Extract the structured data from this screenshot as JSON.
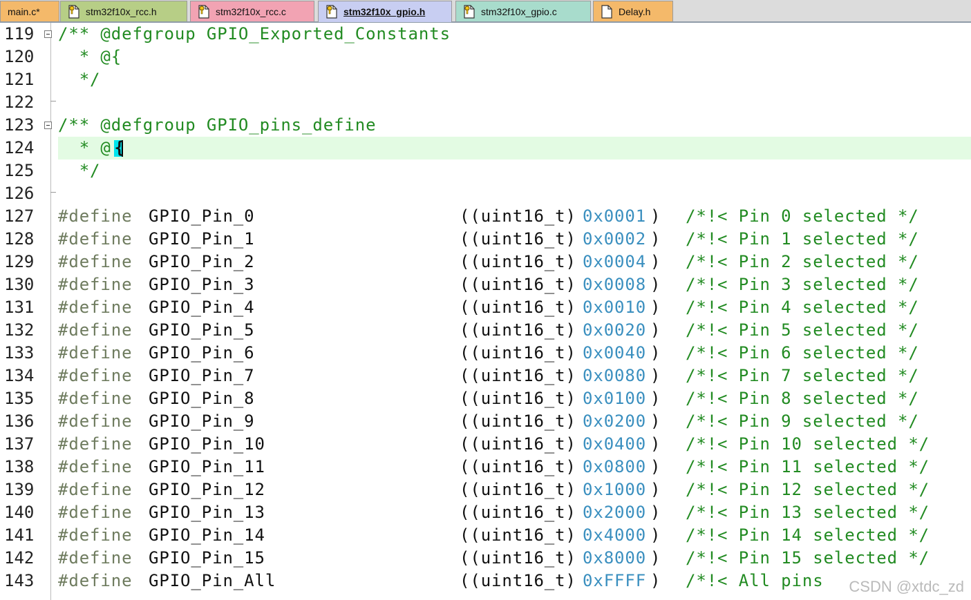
{
  "tabs": [
    {
      "label": "main.c*",
      "color": "#f4b96a",
      "icon": "none"
    },
    {
      "label": "stm32f10x_rcc.h",
      "color": "#b7ce86",
      "icon": "file-key-icon"
    },
    {
      "label": "stm32f10x_rcc.c",
      "color": "#f2a3b3",
      "icon": "file-key-icon"
    },
    {
      "label": "stm32f10x_gpio.h",
      "color": "#c8cef2",
      "icon": "file-key-icon",
      "active": true
    },
    {
      "label": "stm32f10x_gpio.c",
      "color": "#a8dccc",
      "icon": "file-key-icon"
    },
    {
      "label": "Delay.h",
      "color": "#f4b96a",
      "icon": "file-icon"
    }
  ],
  "lines": [
    {
      "num": "119",
      "fold": true,
      "comment": "/** @defgroup GPIO_Exported_Constants"
    },
    {
      "num": "120",
      "comment": "  * @{"
    },
    {
      "num": "121",
      "comment": "  */"
    },
    {
      "num": "122",
      "foldtail": true
    },
    {
      "num": "123",
      "fold": true,
      "comment": "/** @defgroup GPIO_pins_define"
    },
    {
      "num": "124",
      "current": true,
      "comment": "  * @",
      "cursor_char": "{"
    },
    {
      "num": "125",
      "comment": "  */"
    },
    {
      "num": "126",
      "foldtail": true
    },
    {
      "num": "127",
      "define": "#define",
      "name": "GPIO_Pin_0",
      "cast": "((uint16_t)",
      "value": "0x0001",
      "close": ")",
      "comment": "/*!< Pin 0 selected */"
    },
    {
      "num": "128",
      "define": "#define",
      "name": "GPIO_Pin_1",
      "cast": "((uint16_t)",
      "value": "0x0002",
      "close": ")",
      "comment": "/*!< Pin 1 selected */"
    },
    {
      "num": "129",
      "define": "#define",
      "name": "GPIO_Pin_2",
      "cast": "((uint16_t)",
      "value": "0x0004",
      "close": ")",
      "comment": "/*!< Pin 2 selected */"
    },
    {
      "num": "130",
      "define": "#define",
      "name": "GPIO_Pin_3",
      "cast": "((uint16_t)",
      "value": "0x0008",
      "close": ")",
      "comment": "/*!< Pin 3 selected */"
    },
    {
      "num": "131",
      "define": "#define",
      "name": "GPIO_Pin_4",
      "cast": "((uint16_t)",
      "value": "0x0010",
      "close": ")",
      "comment": "/*!< Pin 4 selected */"
    },
    {
      "num": "132",
      "define": "#define",
      "name": "GPIO_Pin_5",
      "cast": "((uint16_t)",
      "value": "0x0020",
      "close": ")",
      "comment": "/*!< Pin 5 selected */"
    },
    {
      "num": "133",
      "define": "#define",
      "name": "GPIO_Pin_6",
      "cast": "((uint16_t)",
      "value": "0x0040",
      "close": ")",
      "comment": "/*!< Pin 6 selected */"
    },
    {
      "num": "134",
      "define": "#define",
      "name": "GPIO_Pin_7",
      "cast": "((uint16_t)",
      "value": "0x0080",
      "close": ")",
      "comment": "/*!< Pin 7 selected */"
    },
    {
      "num": "135",
      "define": "#define",
      "name": "GPIO_Pin_8",
      "cast": "((uint16_t)",
      "value": "0x0100",
      "close": ")",
      "comment": "/*!< Pin 8 selected */"
    },
    {
      "num": "136",
      "define": "#define",
      "name": "GPIO_Pin_9",
      "cast": "((uint16_t)",
      "value": "0x0200",
      "close": ")",
      "comment": "/*!< Pin 9 selected */"
    },
    {
      "num": "137",
      "define": "#define",
      "name": "GPIO_Pin_10",
      "cast": "((uint16_t)",
      "value": "0x0400",
      "close": ")",
      "comment": "/*!< Pin 10 selected */"
    },
    {
      "num": "138",
      "define": "#define",
      "name": "GPIO_Pin_11",
      "cast": "((uint16_t)",
      "value": "0x0800",
      "close": ")",
      "comment": "/*!< Pin 11 selected */"
    },
    {
      "num": "139",
      "define": "#define",
      "name": "GPIO_Pin_12",
      "cast": "((uint16_t)",
      "value": "0x1000",
      "close": ")",
      "comment": "/*!< Pin 12 selected */"
    },
    {
      "num": "140",
      "define": "#define",
      "name": "GPIO_Pin_13",
      "cast": "((uint16_t)",
      "value": "0x2000",
      "close": ")",
      "comment": "/*!< Pin 13 selected */"
    },
    {
      "num": "141",
      "define": "#define",
      "name": "GPIO_Pin_14",
      "cast": "((uint16_t)",
      "value": "0x4000",
      "close": ")",
      "comment": "/*!< Pin 14 selected */"
    },
    {
      "num": "142",
      "define": "#define",
      "name": "GPIO_Pin_15",
      "cast": "((uint16_t)",
      "value": "0x8000",
      "close": ")",
      "comment": "/*!< Pin 15 selected */"
    },
    {
      "num": "143",
      "define": "#define",
      "name": "GPIO_Pin_All",
      "cast": "((uint16_t)",
      "value": "0xFFFF",
      "close": ")",
      "comment": "/*!< All pins"
    }
  ],
  "watermark": "CSDN @xtdc_zd",
  "colors": {
    "comment": "#228b22",
    "preprocessor": "#6e7b5e",
    "number": "#3a8fbf",
    "current_line": "#e3fbe3",
    "cursor": "#00e5ee"
  }
}
